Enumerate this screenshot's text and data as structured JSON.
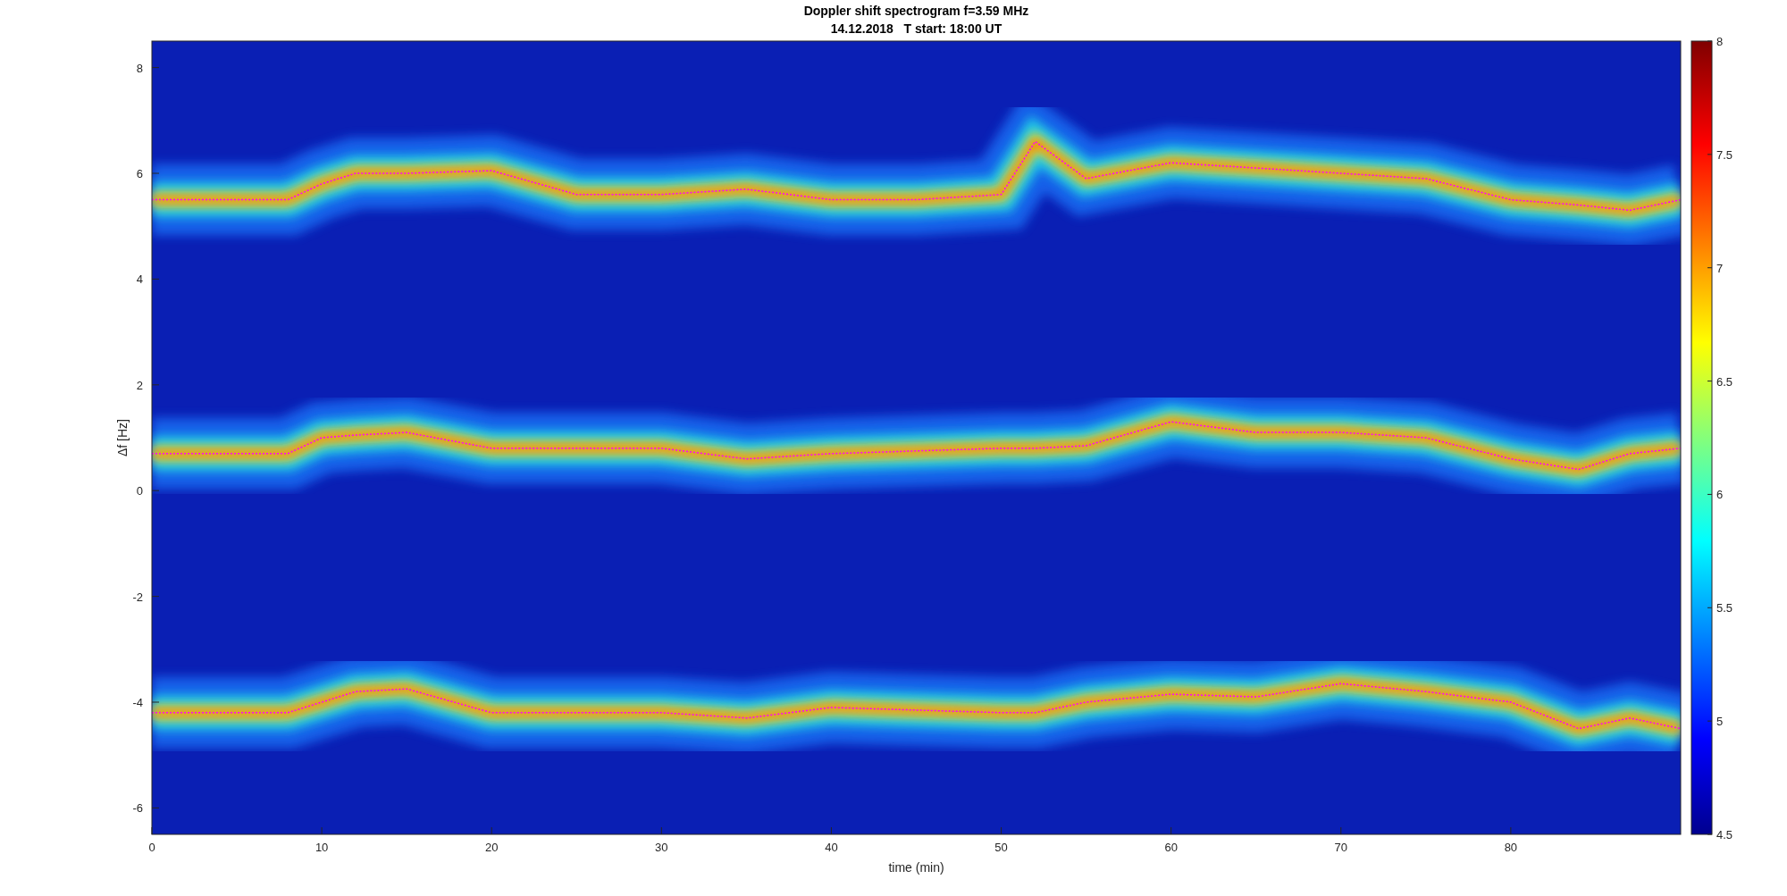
{
  "figure": {
    "subtitle": "14.12.2018   T start: 18:00 UT"
  },
  "chart_data": {
    "type": "line",
    "title": "Doppler shift spectrogram f=3.59 MHz",
    "xlabel": "time (min)",
    "ylabel": "Δf [Hz]",
    "xlim": [
      0,
      90
    ],
    "ylim": [
      -6.5,
      8.5
    ],
    "xticks": [
      0,
      10,
      20,
      30,
      40,
      50,
      60,
      70,
      80
    ],
    "yticks": [
      -6,
      -4,
      -2,
      0,
      2,
      4,
      6,
      8
    ],
    "x": [
      0,
      5,
      8,
      10,
      12,
      15,
      20,
      25,
      30,
      35,
      40,
      45,
      50,
      52,
      55,
      60,
      65,
      70,
      75,
      80,
      84,
      87,
      90
    ],
    "series": [
      {
        "color": "#ff00ff",
        "line_style": "dotted",
        "values": [
          5.5,
          5.5,
          5.5,
          5.8,
          6.0,
          6.0,
          6.05,
          5.6,
          5.6,
          5.7,
          5.5,
          5.5,
          5.6,
          6.6,
          5.9,
          6.2,
          6.1,
          6.0,
          5.9,
          5.5,
          5.4,
          5.3,
          5.5
        ]
      },
      {
        "color": "#ff00ff",
        "line_style": "dotted",
        "values": [
          0.7,
          0.7,
          0.7,
          1.0,
          1.05,
          1.1,
          0.8,
          0.8,
          0.8,
          0.6,
          0.7,
          0.75,
          0.8,
          0.8,
          0.85,
          1.3,
          1.1,
          1.1,
          1.0,
          0.6,
          0.4,
          0.7,
          0.8
        ]
      },
      {
        "color": "#ff00ff",
        "line_style": "dotted",
        "values": [
          -4.2,
          -4.2,
          -4.2,
          -4.0,
          -3.8,
          -3.75,
          -4.2,
          -4.2,
          -4.2,
          -4.3,
          -4.1,
          -4.15,
          -4.2,
          -4.2,
          -4.0,
          -3.85,
          -3.9,
          -3.65,
          -3.8,
          -4.0,
          -4.5,
          -4.3,
          -4.5
        ]
      }
    ]
  },
  "colorbar": {
    "ticks": [
      "8",
      "7.5",
      "7",
      "6.5",
      "6",
      "5.5",
      "5",
      "4.5"
    ]
  }
}
